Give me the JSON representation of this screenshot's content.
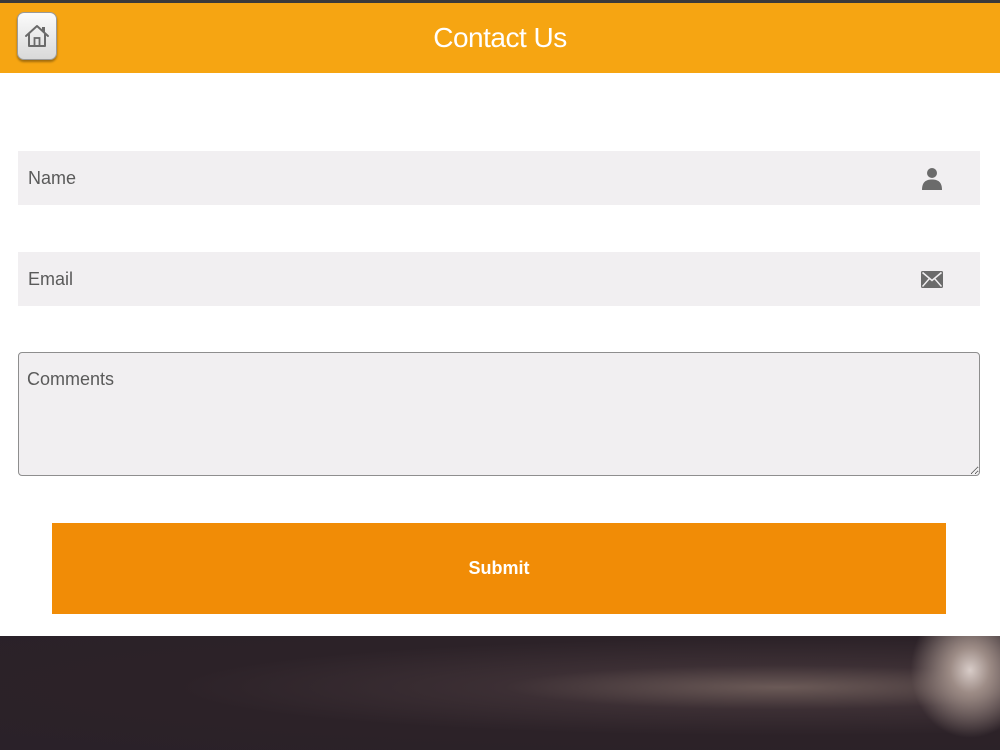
{
  "header": {
    "title": "Contact Us",
    "home_icon": "home-icon",
    "background_color": "#f6a512"
  },
  "form": {
    "name": {
      "placeholder": "Name",
      "icon": "user-icon"
    },
    "email": {
      "placeholder": "Email",
      "icon": "envelope-icon"
    },
    "comments": {
      "placeholder": "Comments"
    },
    "submit_label": "Submit",
    "submit_color": "#f18c06"
  }
}
